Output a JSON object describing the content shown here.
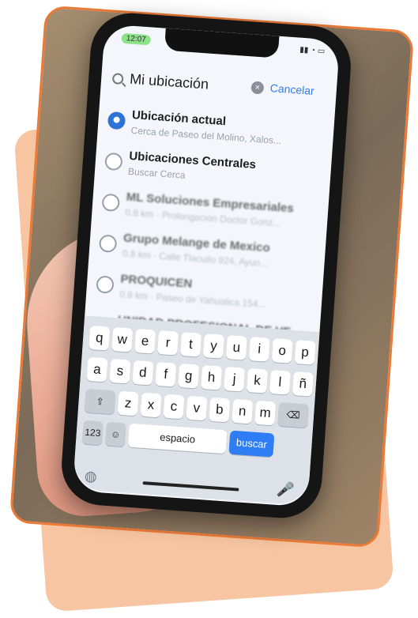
{
  "status": {
    "time": "12:07",
    "icons": "▮▮ ◔ ▭"
  },
  "search": {
    "query": "Mi ubicación",
    "cancel": "Cancelar"
  },
  "results": [
    {
      "title": "Ubicación actual",
      "subtitle": "Cerca de Paseo del Molino, Xalos..."
    },
    {
      "title": "Ubicaciones Centrales",
      "subtitle": "Buscar Cerca"
    },
    {
      "title": "ML Soluciones Empresariales",
      "subtitle": "0.8 km · Prolongación Doctor Gonz..."
    },
    {
      "title": "Grupo Melange de Mexico",
      "subtitle": "0.8 km · Calle Tlacuilo 924, Ayun..."
    },
    {
      "title": "PROQUICEN",
      "subtitle": "0.8 km · Paseo de Yahualica 154..."
    },
    {
      "title": "UNIDAD PROFESIONAL DE VE...",
      "subtitle": ""
    }
  ],
  "keyboard": {
    "row1": [
      "q",
      "w",
      "e",
      "r",
      "t",
      "y",
      "u",
      "i",
      "o",
      "p"
    ],
    "row2": [
      "a",
      "s",
      "d",
      "f",
      "g",
      "h",
      "j",
      "k",
      "l",
      "ñ"
    ],
    "row3": [
      "z",
      "x",
      "c",
      "v",
      "b",
      "n",
      "m"
    ],
    "numbers_key": "123",
    "space_key": "espacio",
    "search_key": "buscar"
  },
  "icons": {
    "search": "search-icon",
    "clear": "clear-icon",
    "location": "location-icon",
    "shift": "⇧",
    "delete": "⌫",
    "emoji": "☺",
    "globe": "◍",
    "mic": "🎤"
  }
}
